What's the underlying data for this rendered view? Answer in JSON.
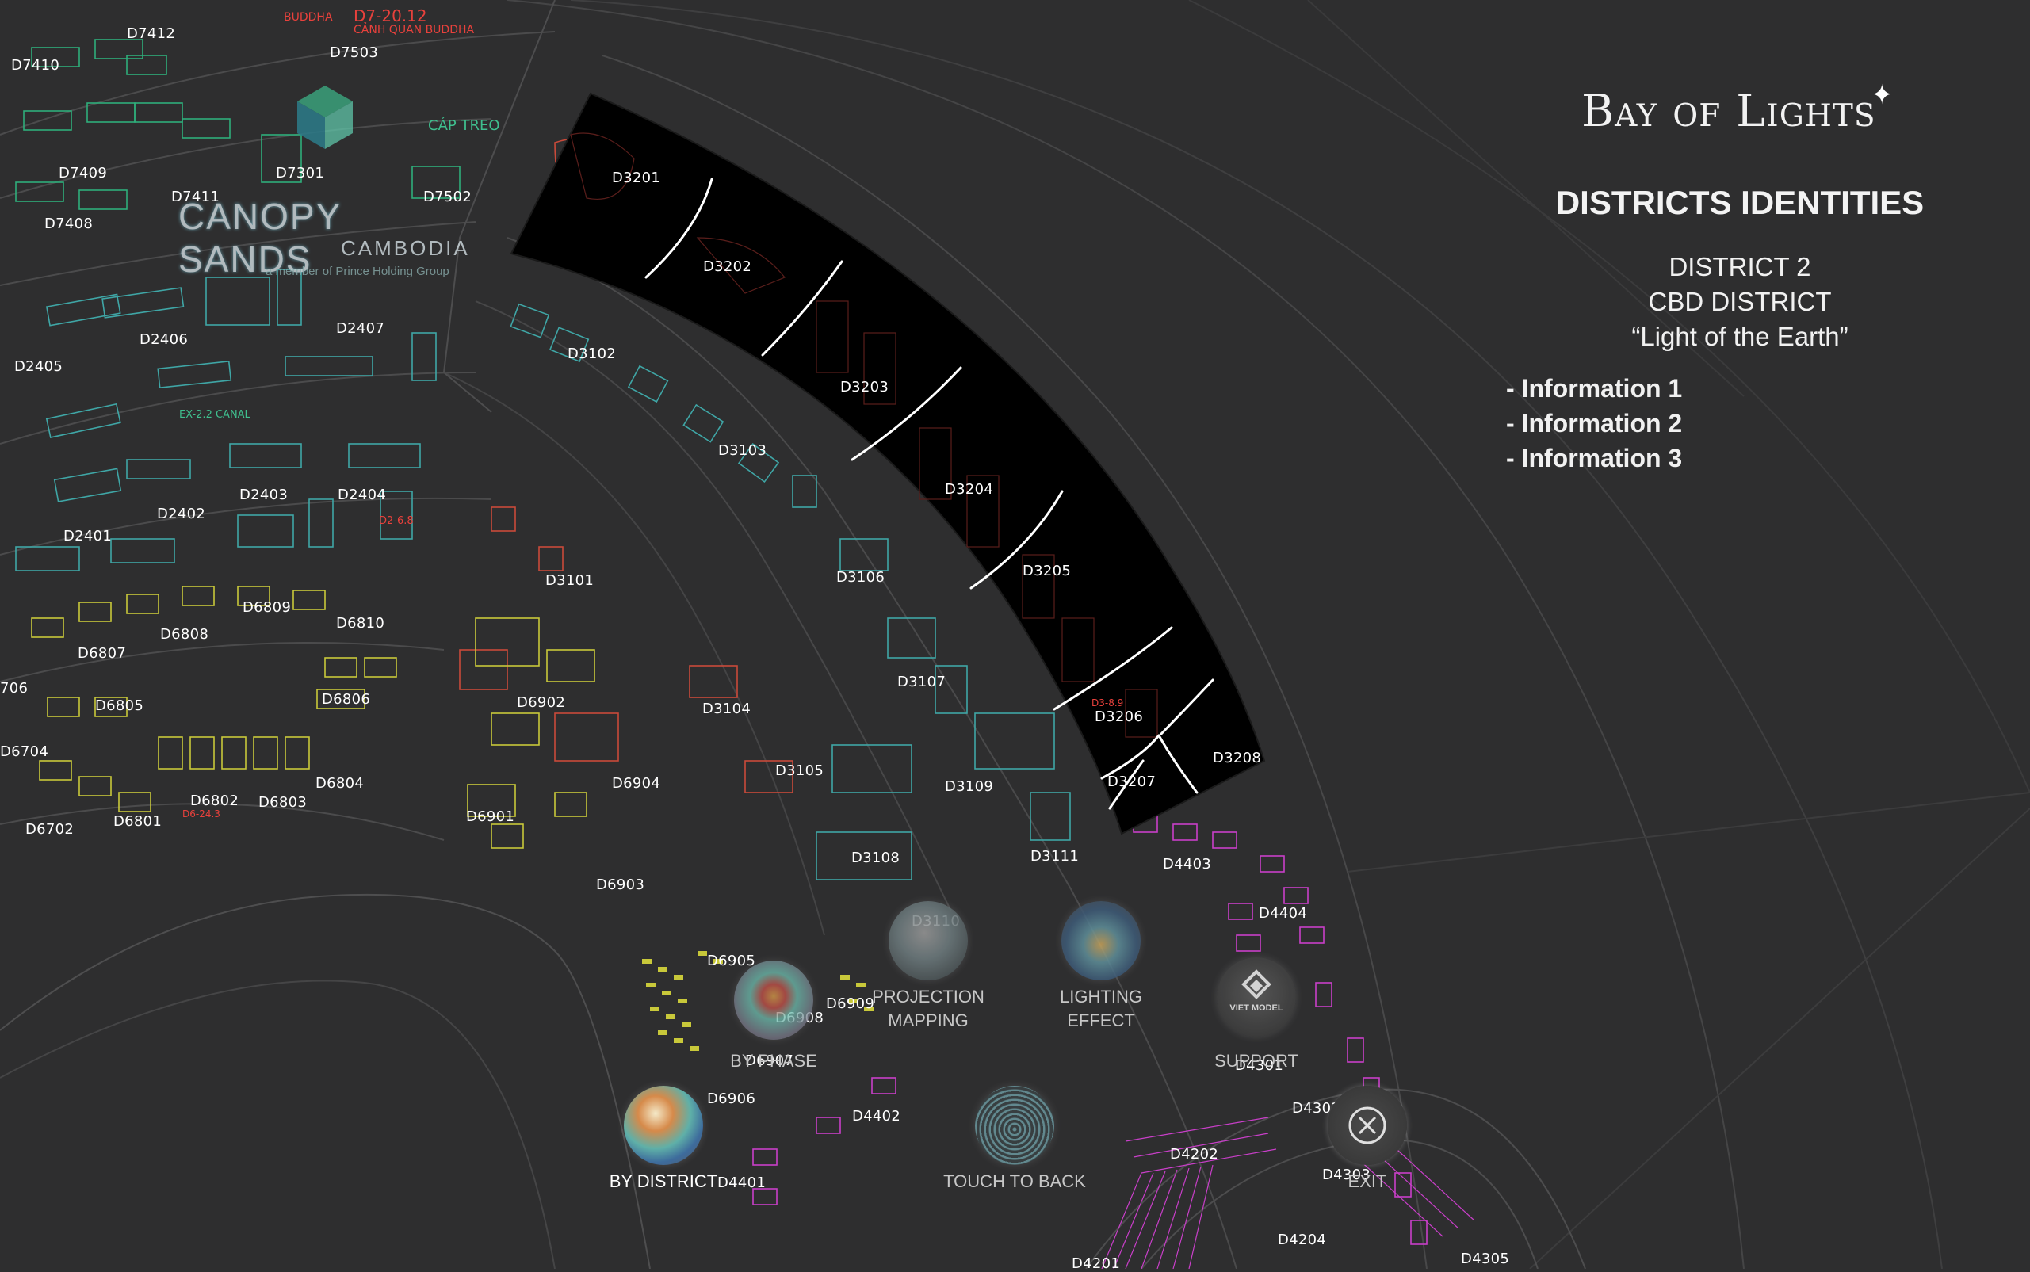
{
  "brand": {
    "name": "Bay of Lights",
    "star": "✦"
  },
  "logo": {
    "name": "CANOPY SANDS",
    "country": "CAMBODIA",
    "tagline": "a member of Prince Holding Group"
  },
  "panel": {
    "title": "DISTRICTS IDENTITIES",
    "district": "DISTRICT 2",
    "subtitle": "CBD DISTRICT",
    "tagline": "“Light of the Earth”",
    "info": [
      "- Information 1",
      "- Information 2",
      "- Information 3"
    ]
  },
  "map": {
    "highlight_color": "#000000",
    "plot_labels": [
      "D7412",
      "D7503",
      "D7410",
      "D7409",
      "D7301",
      "D7502",
      "D7411",
      "D7408",
      "D3201",
      "D3202",
      "D2406",
      "D2407",
      "D2405",
      "D3102",
      "D3203",
      "D3103",
      "D2403",
      "D2404",
      "D2402",
      "D2401",
      "D3204",
      "D3101",
      "D3205",
      "D3106",
      "D6809",
      "D6810",
      "D6808",
      "D6807",
      "D3107",
      "D6902",
      "D6806",
      "D6805",
      "D3104",
      "D3206",
      "D3208",
      "D3207",
      "D6704",
      "D6904",
      "D3105",
      "D3109",
      "D6804",
      "D6802",
      "D6803",
      "D6901",
      "D6702",
      "D6801",
      "D3108",
      "D3111",
      "D4403",
      "D6903",
      "D3110",
      "D4404",
      "D6905",
      "D6909",
      "D6908",
      "D6907",
      "D4301",
      "D6906",
      "D4302",
      "D4402",
      "D4202",
      "D4303",
      "D4401",
      "D4204",
      "D4201",
      "D4305",
      "706"
    ],
    "red_labels": [
      {
        "text": "BUDDHA"
      },
      {
        "text": "D7-20.12"
      },
      {
        "text": "CẢNH QUAN BUDDHA"
      },
      {
        "text": "D3-8.9"
      },
      {
        "text": "D6-24.3"
      },
      {
        "text": "D2-6.8"
      }
    ],
    "green_labels": [
      {
        "text": "CÁP TREO"
      },
      {
        "text": "EX-2.2 CANAL"
      }
    ]
  },
  "menu": [
    {
      "label_1": "BY DISTRICT",
      "label_2": "",
      "icon": "district-orb-icon"
    },
    {
      "label_1": "BY PHASE",
      "label_2": "",
      "icon": "phase-orb-icon"
    },
    {
      "label_1": "PROJECTION",
      "label_2": "MAPPING",
      "icon": "projection-orb-icon"
    },
    {
      "label_1": "LIGHTING",
      "label_2": "EFFECT",
      "icon": "lighting-orb-icon"
    },
    {
      "label_1": "TOUCH TO BACK",
      "label_2": "",
      "icon": "fingerprint-icon"
    },
    {
      "label_1": "SUPPORT",
      "label_2": "",
      "icon": "viet-model-logo-icon"
    },
    {
      "label_1": "EXIT",
      "label_2": "",
      "icon": "close-icon"
    }
  ],
  "support_logo_text": "VIET MODEL"
}
